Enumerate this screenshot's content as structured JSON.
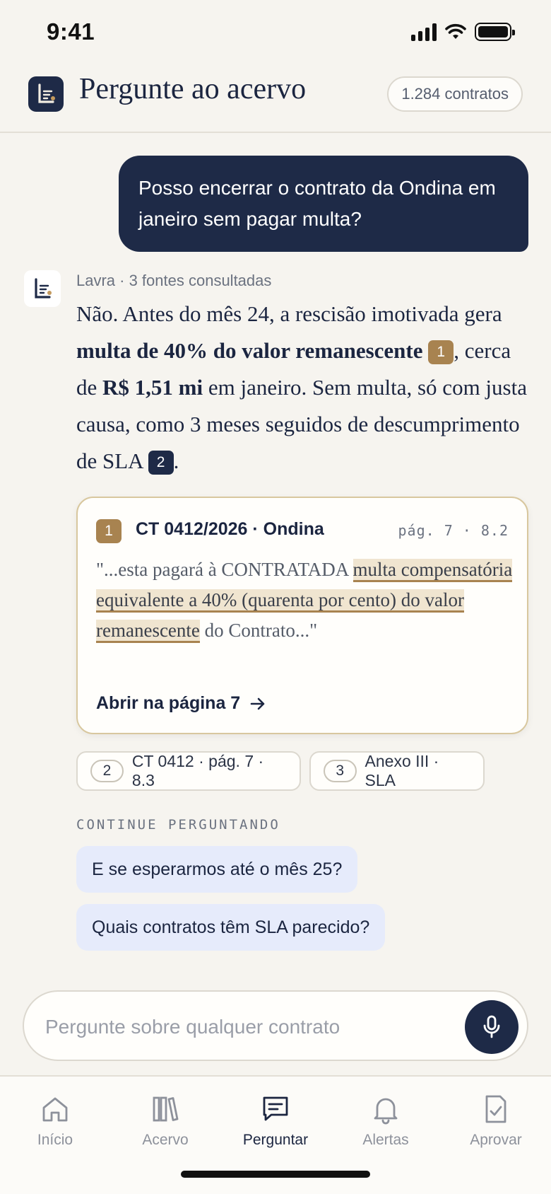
{
  "status_bar": {
    "time": "9:41"
  },
  "header": {
    "title": "Pergunte ao acervo",
    "contracts_count": "1.284 contratos"
  },
  "user_message": "Posso encerrar o contrato da Ondina em janeiro sem pagar multa?",
  "assistant": {
    "meta": "Lavra · 3 fontes consultadas",
    "answer": {
      "p1": "Não. Antes do mês 24, a rescisão imotivada gera ",
      "b1": "multa de 40% do valor remanescente",
      "cite1": "1",
      "p2": ", cerca de ",
      "b2": "R$ 1,51 mi",
      "p3": " em janeiro. Sem multa, só com justa causa, como 3 meses seguidos de descumprimento de SLA ",
      "cite2": "2",
      "p4": "."
    }
  },
  "source_card": {
    "badge": "1",
    "title": "CT 0412/2026 · Ondina",
    "page_ref": "pág. 7 · 8.2",
    "quote_before": "\"...esta pagará à CONTRATADA ",
    "quote_highlight": "multa compensatória equivalente a 40% (quarenta por cento) do valor remanescente",
    "quote_after": " do Contrato...\"",
    "link_label": "Abrir na página 7"
  },
  "other_sources": [
    {
      "num": "2",
      "label": "CT 0412 · pág. 7 · 8.3"
    },
    {
      "num": "3",
      "label": "Anexo III · SLA"
    }
  ],
  "continue": {
    "label": "CONTINUE PERGUNTANDO",
    "suggestions": [
      "E se esperarmos até o mês 25?",
      "Quais contratos têm SLA parecido?"
    ]
  },
  "input": {
    "placeholder": "Pergunte sobre qualquer contrato",
    "value": ""
  },
  "tabs": [
    {
      "label": "Início",
      "icon": "home-icon",
      "active": false
    },
    {
      "label": "Acervo",
      "icon": "books-icon",
      "active": false
    },
    {
      "label": "Perguntar",
      "icon": "chat-icon",
      "active": true
    },
    {
      "label": "Alertas",
      "icon": "bell-icon",
      "active": false
    },
    {
      "label": "Aprovar",
      "icon": "approve-document-icon",
      "active": false
    }
  ],
  "colors": {
    "navy": "#1e2a47",
    "gold": "#a88350",
    "background": "#f6f4ef",
    "suggestion_bg": "#e6ebfb",
    "highlight_bg": "#f0e5d0"
  }
}
